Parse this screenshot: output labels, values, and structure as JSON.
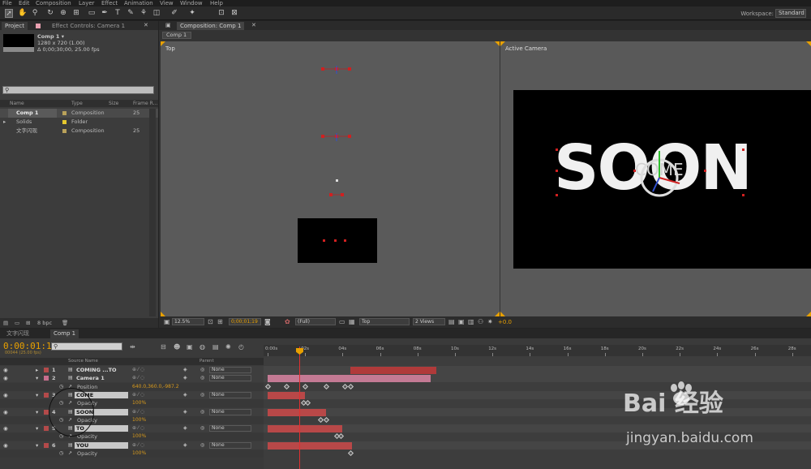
{
  "menu": [
    "File",
    "Edit",
    "Composition",
    "Layer",
    "Effect",
    "Animation",
    "View",
    "Window",
    "Help"
  ],
  "workspace": {
    "label": "Workspace:",
    "value": "Standard"
  },
  "project": {
    "tab_project": "Project",
    "tab_effect": "Effect Controls: Camera 1",
    "comp_name": "Comp 1 ▾",
    "comp_size": "1280 x 720 (1.00)",
    "comp_dur": "Δ 0;00;30;00, 25.00 fps",
    "columns": [
      "Name",
      "Type",
      "Size",
      "Frame R..."
    ],
    "items": [
      {
        "name": "Comp 1",
        "type": "Composition",
        "fr": "25",
        "color": "#b9a15a"
      },
      {
        "name": "Solids",
        "type": "Folder",
        "fr": "",
        "color": "#e6c82e"
      },
      {
        "name": "文字闪现",
        "type": "Composition",
        "fr": "25",
        "color": "#b9a15a"
      }
    ],
    "bpc": "8 bpc"
  },
  "comp": {
    "tab": "Composition: Comp 1",
    "sub_tab": "Comp 1",
    "left_view": "Top",
    "right_view": "Active Camera",
    "big_text": "SOON",
    "small_text": "COME",
    "zoom": "12.5%",
    "time": "0;00;01;19",
    "resolution": "(Full)",
    "view": "Top",
    "views": "2 Views",
    "exposure": "+0.0",
    "accent": "#e8a000"
  },
  "timeline": {
    "tabs": [
      "文字闪现",
      "Comp 1"
    ],
    "time": "0:00:01:19",
    "fps": "00044 (25.00 fps)",
    "col_source": "Source Name",
    "col_parent": "Parent",
    "ruler": [
      "0:00s",
      "02s",
      "04s",
      "06s",
      "08s",
      "10s",
      "12s",
      "14s",
      "16s",
      "18s",
      "20s",
      "22s",
      "24s",
      "26s",
      "28s"
    ],
    "layers": [
      {
        "num": "1",
        "name": "COMING ...TO YOU",
        "parent": "None",
        "label": "#b34a4a",
        "kind": "layer"
      },
      {
        "num": "2",
        "name": "Camera 1",
        "parent": "None",
        "label": "#c86e8e",
        "kind": "layer"
      },
      {
        "prop": "Position",
        "value": "640.0,360.0,-987.2",
        "kind": "prop"
      },
      {
        "num": "3",
        "name": "COME",
        "parent": "None",
        "label": "#b34a4a",
        "kind": "layer",
        "selected": true
      },
      {
        "prop": "Opacity",
        "value": "100%",
        "kind": "prop"
      },
      {
        "num": "4",
        "name": "SOON",
        "parent": "None",
        "label": "#b34a4a",
        "kind": "layer",
        "selected": true
      },
      {
        "prop": "Opacity",
        "value": "100%",
        "kind": "prop"
      },
      {
        "num": "5",
        "name": "TO",
        "parent": "None",
        "label": "#b34a4a",
        "kind": "layer",
        "selected": true
      },
      {
        "prop": "Opacity",
        "value": "100%",
        "kind": "prop"
      },
      {
        "num": "6",
        "name": "YOU",
        "parent": "None",
        "label": "#b34a4a",
        "kind": "layer",
        "selected": true
      },
      {
        "prop": "Opacity",
        "value": "100%",
        "kind": "prop"
      }
    ]
  },
  "watermark": {
    "logo": "Bai  经验",
    "url": "jingyan.baidu.com"
  }
}
